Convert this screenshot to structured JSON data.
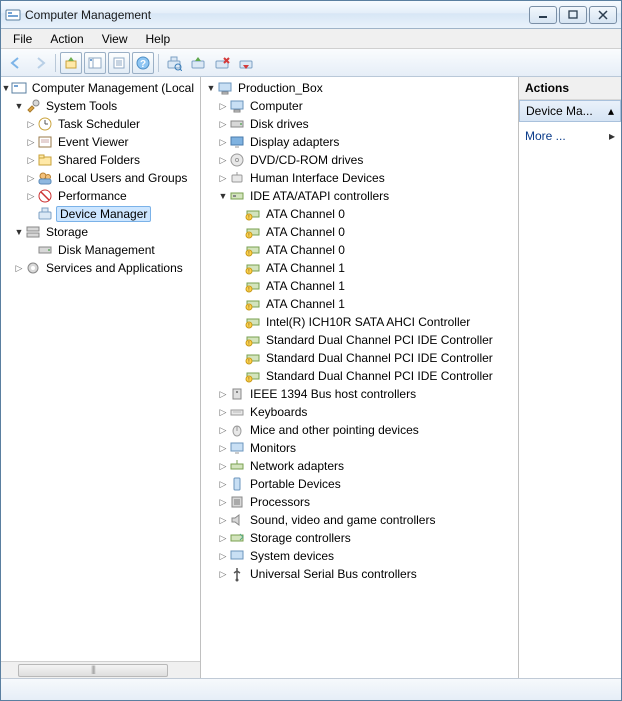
{
  "window": {
    "title": "Computer Management"
  },
  "menu": {
    "file": "File",
    "action": "Action",
    "view": "View",
    "help": "Help"
  },
  "left_tree": {
    "root": "Computer Management (Local",
    "system_tools": "System Tools",
    "task_scheduler": "Task Scheduler",
    "event_viewer": "Event Viewer",
    "shared_folders": "Shared Folders",
    "local_users": "Local Users and Groups",
    "performance": "Performance",
    "device_manager": "Device Manager",
    "storage": "Storage",
    "disk_management": "Disk Management",
    "services_apps": "Services and Applications"
  },
  "mid_tree": {
    "root": "Production_Box",
    "computer": "Computer",
    "disk_drives": "Disk drives",
    "display_adapters": "Display adapters",
    "dvd": "DVD/CD-ROM drives",
    "hid": "Human Interface Devices",
    "ide": "IDE ATA/ATAPI controllers",
    "ide_children": [
      "ATA Channel 0",
      "ATA Channel 0",
      "ATA Channel 0",
      "ATA Channel 1",
      "ATA Channel 1",
      "ATA Channel 1",
      "Intel(R) ICH10R SATA AHCI Controller",
      "Standard Dual Channel PCI IDE Controller",
      "Standard Dual Channel PCI IDE Controller",
      "Standard Dual Channel PCI IDE Controller"
    ],
    "ieee1394": "IEEE 1394 Bus host controllers",
    "keyboards": "Keyboards",
    "mice": "Mice and other pointing devices",
    "monitors": "Monitors",
    "network": "Network adapters",
    "portable": "Portable Devices",
    "processors": "Processors",
    "sound": "Sound, video and game controllers",
    "storage_ctrl": "Storage controllers",
    "system_devices": "System devices",
    "usb": "Universal Serial Bus controllers"
  },
  "actions": {
    "header": "Actions",
    "selected": "Device Ma...",
    "more": "More ..."
  }
}
